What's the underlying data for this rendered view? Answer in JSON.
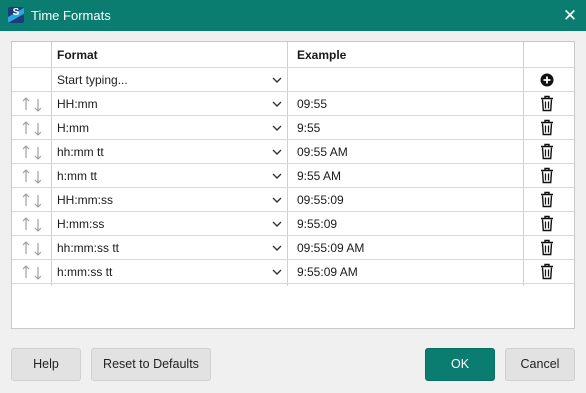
{
  "window": {
    "title": "Time Formats",
    "app_icon_letter": "S",
    "close_glyph": "✕"
  },
  "table": {
    "headers": {
      "format": "Format",
      "example": "Example"
    },
    "new_row": {
      "placeholder": "Start typing...",
      "example": ""
    },
    "rows": [
      {
        "format": "HH:mm",
        "example": "09:55"
      },
      {
        "format": "H:mm",
        "example": "9:55"
      },
      {
        "format": "hh:mm tt",
        "example": "09:55 AM"
      },
      {
        "format": "h:mm tt",
        "example": "9:55 AM"
      },
      {
        "format": "HH:mm:ss",
        "example": "09:55:09"
      },
      {
        "format": "H:mm:ss",
        "example": "9:55:09"
      },
      {
        "format": "hh:mm:ss tt",
        "example": "09:55:09 AM"
      },
      {
        "format": "h:mm:ss tt",
        "example": "9:55:09 AM"
      }
    ]
  },
  "footer": {
    "help_label": "Help",
    "reset_label": "Reset to Defaults",
    "ok_label": "OK",
    "cancel_label": "Cancel"
  },
  "colors": {
    "accent": "#0b7d70",
    "arrow_gray": "#a0a0a0"
  },
  "icons": {
    "add": "plus-circle-icon",
    "delete": "trash-icon",
    "reorder": "move-up-down-icon",
    "dropdown": "chevron-down-icon"
  }
}
